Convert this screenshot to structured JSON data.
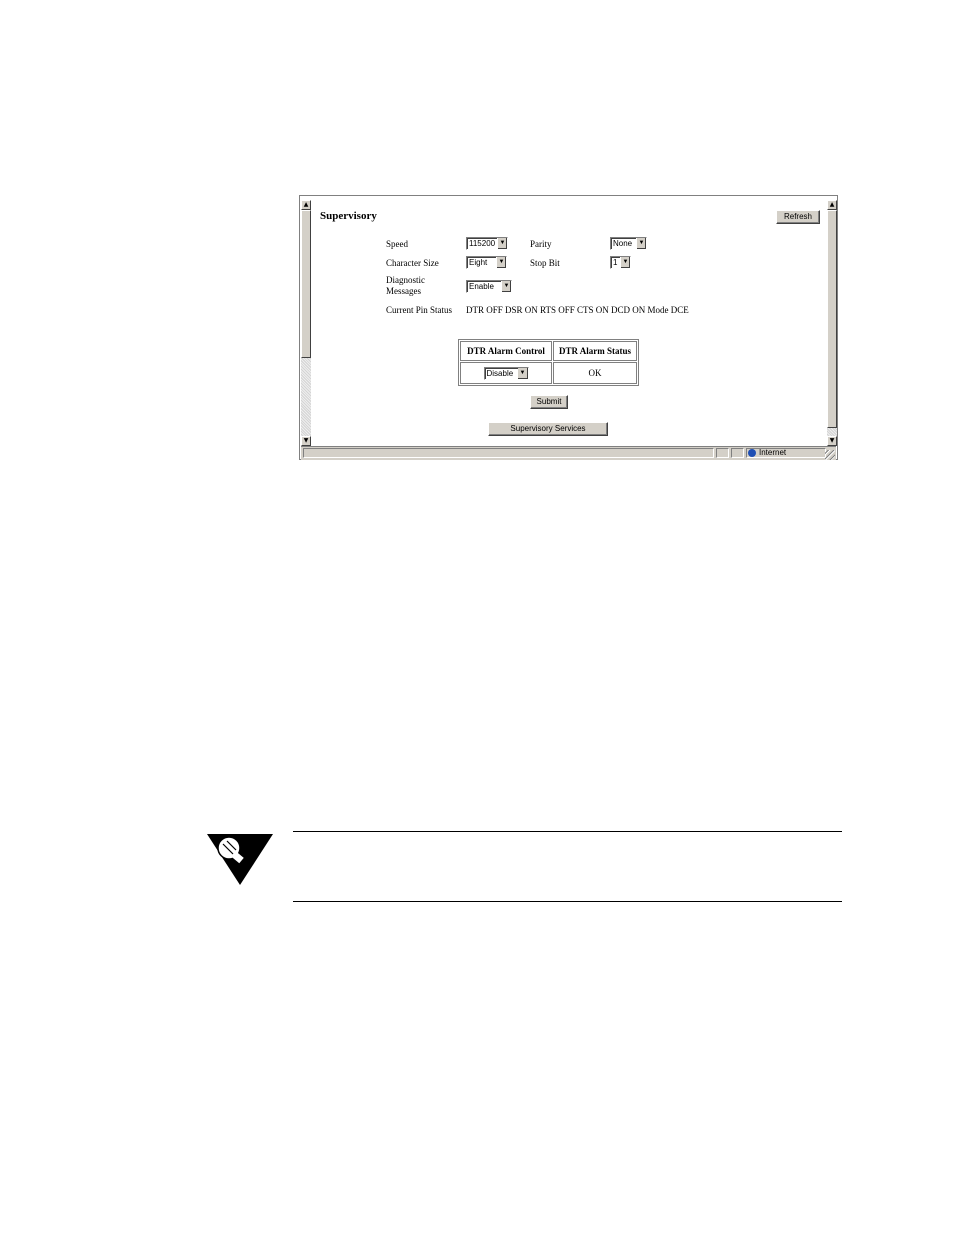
{
  "page": {
    "title": "Supervisory",
    "refresh_label": "Refresh"
  },
  "form": {
    "speed": {
      "label": "Speed",
      "value": "115200"
    },
    "parity": {
      "label": "Parity",
      "value": "None"
    },
    "character_size": {
      "label": "Character Size",
      "value": "Eight"
    },
    "stop_bit": {
      "label": "Stop Bit",
      "value": "1"
    },
    "diagnostic_messages": {
      "label_line1": "Diagnostic",
      "label_line2": "Messages",
      "value": "Enable"
    },
    "current_pin_status": {
      "label": "Current Pin Status",
      "value": "DTR OFF DSR ON RTS OFF CTS ON DCD ON Mode DCE"
    }
  },
  "alarm_table": {
    "headers": [
      "DTR Alarm Control",
      "DTR Alarm Status"
    ],
    "control_value": "Disable",
    "status_value": "OK"
  },
  "buttons": {
    "submit": "Submit",
    "supervisory_services": "Supervisory Services"
  },
  "statusbar": {
    "zone": "Internet"
  },
  "icons": {
    "scroll_up": "scroll-up-icon",
    "scroll_down": "scroll-down-icon",
    "dropdown": "chevron-down-icon",
    "zone": "globe-icon",
    "note": "lightbulb-icon"
  }
}
